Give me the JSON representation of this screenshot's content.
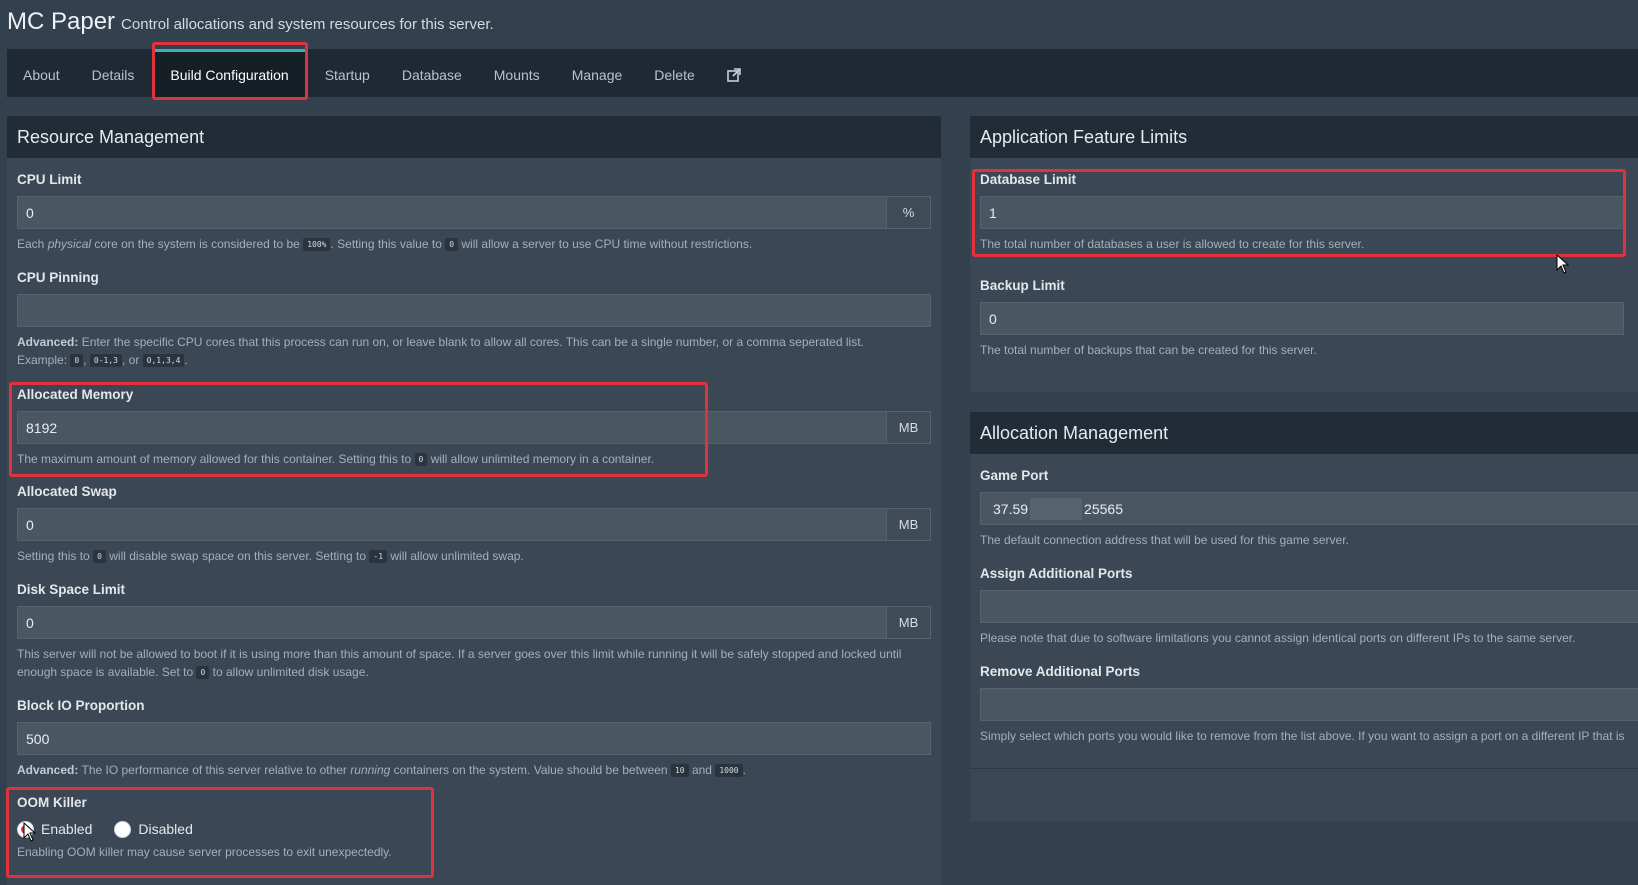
{
  "header": {
    "title": "MC Paper",
    "subtitle": "Control allocations and system resources for this server."
  },
  "tabs": [
    {
      "label": "About"
    },
    {
      "label": "Details"
    },
    {
      "label": "Build Configuration",
      "active": true
    },
    {
      "label": "Startup"
    },
    {
      "label": "Database"
    },
    {
      "label": "Mounts"
    },
    {
      "label": "Manage"
    },
    {
      "label": "Delete"
    }
  ],
  "external_link_icon": "external-link-icon",
  "resource": {
    "title": "Resource Management",
    "cpu_limit": {
      "label": "CPU Limit",
      "value": "0",
      "addon": "%",
      "help_pre": "Each",
      "help_em": "physical",
      "help_mid": "core on the system is considered to be",
      "code1": "100%",
      "help_mid2": ". Setting this value to",
      "code2": "0",
      "help_post": "will allow a server to use CPU time without restrictions."
    },
    "cpu_pinning": {
      "label": "CPU Pinning",
      "value": "",
      "help_bold": "Advanced:",
      "help_text": "Enter the specific CPU cores that this process can run on, or leave blank to allow all cores. This can be a single number, or a comma seperated list.",
      "example_label": "Example:",
      "code1": "0",
      "sep1": ",",
      "code2": "0-1,3",
      "sep2": ", or",
      "code3": "0,1,3,4",
      "end": "."
    },
    "memory": {
      "label": "Allocated Memory",
      "value": "8192",
      "addon": "MB",
      "help_pre": "The maximum amount of memory allowed for this container. Setting this to",
      "code": "0",
      "help_post": "will allow unlimited memory in a container."
    },
    "swap": {
      "label": "Allocated Swap",
      "value": "0",
      "addon": "MB",
      "help_pre": "Setting this to",
      "code1": "0",
      "help_mid": "will disable swap space on this server. Setting to",
      "code2": "-1",
      "help_post": "will allow unlimited swap."
    },
    "disk": {
      "label": "Disk Space Limit",
      "value": "0",
      "addon": "MB",
      "help_pre": "This server will not be allowed to boot if it is using more than this amount of space. If a server goes over this limit while running it will be safely stopped and locked until enough space is available. Set to",
      "code": "0",
      "help_post": "to allow unlimited disk usage."
    },
    "block_io": {
      "label": "Block IO Proportion",
      "value": "500",
      "help_bold": "Advanced:",
      "help_pre": "The IO performance of this server relative to other",
      "help_em": "running",
      "help_mid": "containers on the system. Value should be between",
      "code1": "10",
      "help_and": "and",
      "code2": "1000",
      "end": "."
    },
    "oom": {
      "label": "OOM Killer",
      "enabled": "Enabled",
      "disabled": "Disabled",
      "help": "Enabling OOM killer may cause server processes to exit unexpectedly."
    }
  },
  "features": {
    "title": "Application Feature Limits",
    "database": {
      "label": "Database Limit",
      "value": "1",
      "help": "The total number of databases a user is allowed to create for this server."
    },
    "backup": {
      "label": "Backup Limit",
      "value": "0",
      "help": "The total number of backups that can be created for this server."
    }
  },
  "allocation": {
    "title": "Allocation Management",
    "game_port": {
      "label": "Game Port",
      "value_a": "37.59",
      "value_b": "25565",
      "help": "The default connection address that will be used for this game server."
    },
    "assign": {
      "label": "Assign Additional Ports",
      "value": "",
      "help": "Please note that due to software limitations you cannot assign identical ports on different IPs to the same server."
    },
    "remove": {
      "label": "Remove Additional Ports",
      "value": "",
      "help": "Simply select which ports you would like to remove from the list above. If you want to assign a port on a different IP that is"
    }
  }
}
